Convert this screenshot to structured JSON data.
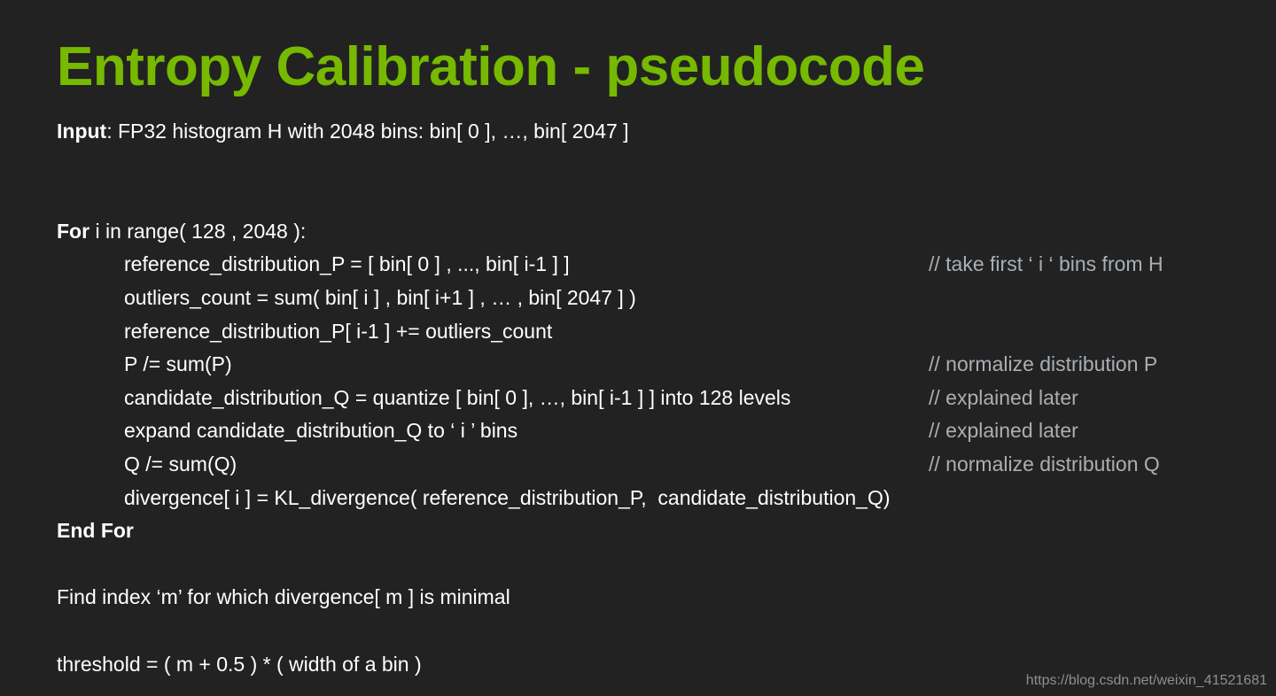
{
  "slide": {
    "title": "Entropy Calibration - pseudocode",
    "title_color": "#76b900",
    "background_color": "#222222",
    "text_color": "#ffffff",
    "comment_color": "#a9afb4"
  },
  "code": {
    "lines": [
      {
        "id": "input",
        "indent": 0,
        "keyword": "Input",
        "text": ": FP32 histogram H with 2048 bins: bin[ 0 ], …, bin[ 2047 ]",
        "comment": ""
      },
      {
        "id": "blank-1",
        "indent": 0,
        "keyword": "",
        "text": "",
        "comment": ""
      },
      {
        "id": "blank-2",
        "indent": 0,
        "keyword": "",
        "text": "",
        "comment": ""
      },
      {
        "id": "for-loop",
        "indent": 0,
        "keyword": "For",
        "text": " i in range( 128 , 2048 ):",
        "comment": ""
      },
      {
        "id": "reference-distribution-p-assign",
        "indent": 1,
        "keyword": "",
        "text": "reference_distribution_P = [ bin[ 0 ] , ..., bin[ i-1 ] ]",
        "comment": "// take first ‘ i ‘ bins from H"
      },
      {
        "id": "outliers-count",
        "indent": 1,
        "keyword": "",
        "text": "outliers_count = sum( bin[ i ] , bin[ i+1 ] , … , bin[ 2047 ] )",
        "comment": ""
      },
      {
        "id": "reference-distribution-p-add-outliers",
        "indent": 1,
        "keyword": "",
        "text": "reference_distribution_P[ i-1 ] += outliers_count",
        "comment": ""
      },
      {
        "id": "normalize-p",
        "indent": 1,
        "keyword": "",
        "text": "P /= sum(P)",
        "comment": "// normalize distribution P"
      },
      {
        "id": "candidate-distribution-q-quantize",
        "indent": 1,
        "keyword": "",
        "text": "candidate_distribution_Q = quantize [ bin[ 0 ], …, bin[ i-1 ] ] into 128 levels",
        "comment": "// explained later"
      },
      {
        "id": "expand-candidate-distribution-q",
        "indent": 1,
        "keyword": "",
        "text": "expand candidate_distribution_Q to ‘ i ’ bins",
        "comment": "// explained later"
      },
      {
        "id": "normalize-q",
        "indent": 1,
        "keyword": "",
        "text": "Q /= sum(Q)",
        "comment": "// normalize distribution Q"
      },
      {
        "id": "divergence-assign",
        "indent": 1,
        "keyword": "",
        "text": "divergence[ i ] = KL_divergence( reference_distribution_P,  candidate_distribution_Q)",
        "comment": ""
      },
      {
        "id": "end-for",
        "indent": 0,
        "keyword": "End For",
        "text": "",
        "comment": ""
      },
      {
        "id": "blank-3",
        "indent": 0,
        "keyword": "",
        "text": "",
        "comment": ""
      },
      {
        "id": "find-index-m",
        "indent": 0,
        "keyword": "",
        "text": "Find index ‘m’ for which divergence[ m ] is minimal",
        "comment": ""
      },
      {
        "id": "blank-4",
        "indent": 0,
        "keyword": "",
        "text": "",
        "comment": ""
      },
      {
        "id": "threshold",
        "indent": 0,
        "keyword": "",
        "text": "threshold = ( m + 0.5 ) * ( width of a bin )",
        "comment": ""
      }
    ]
  },
  "watermark": {
    "text": "https://blog.csdn.net/weixin_41521681"
  }
}
